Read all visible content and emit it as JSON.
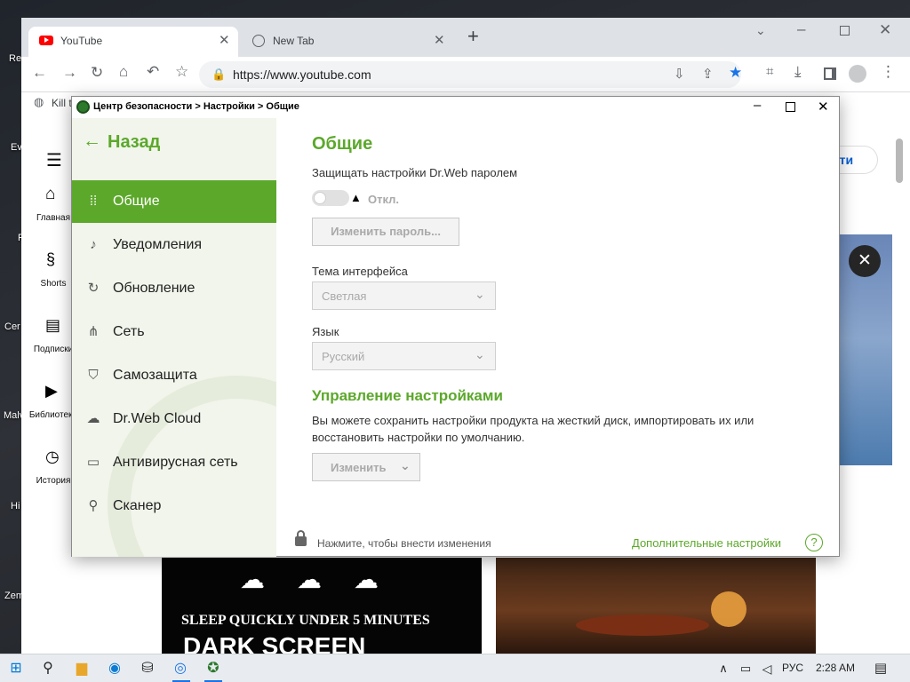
{
  "desktop": {
    "labels": [
      "Re",
      "Ev",
      "F",
      "Cer",
      "Malv",
      "Hi",
      "Zem"
    ]
  },
  "chrome": {
    "tabs": [
      {
        "title": "YouTube"
      },
      {
        "title": "New Tab"
      }
    ],
    "new_tab": "+",
    "url": "https://www.youtube.com",
    "bookmark": "Kill t"
  },
  "youtube": {
    "nav": [
      {
        "label": "Главная"
      },
      {
        "label": "Shorts"
      },
      {
        "label": "Подписки"
      },
      {
        "label": "Библиотека"
      },
      {
        "label": "История"
      }
    ],
    "signin_partial": "йти",
    "thumb_text_1": "SLEEP QUICKLY UNDER 5 MINUTES",
    "thumb_text_2": "DARK SCREEN"
  },
  "drweb": {
    "title": "Центр безопасности > Настройки > Общие",
    "back_label": "Назад",
    "nav": [
      {
        "label": "Общие",
        "active": true
      },
      {
        "label": "Уведомления"
      },
      {
        "label": "Обновление"
      },
      {
        "label": "Сеть"
      },
      {
        "label": "Самозащита"
      },
      {
        "label": "Dr.Web Cloud"
      },
      {
        "label": "Антивирусная сеть"
      },
      {
        "label": "Сканер"
      }
    ],
    "heading": "Общие",
    "password_protect_label": "Защищать настройки Dr.Web паролем",
    "toggle_state": "Откл.",
    "change_password_button": "Изменить пароль...",
    "theme_label": "Тема интерфейса",
    "theme_value": "Светлая",
    "language_label": "Язык",
    "language_value": "Русский",
    "manage_heading": "Управление настройками",
    "manage_description": "Вы можете сохранить настройки продукта на жесткий диск, импортировать их или восстановить настройки по умолчанию.",
    "change_button": "Изменить",
    "lock_hint": "Нажмите, чтобы внести изменения",
    "advanced_link": "Дополнительные настройки",
    "help": "?"
  },
  "taskbar": {
    "language": "РУС",
    "time": "2:28 AM"
  },
  "colors": {
    "accent": "#5ca82b",
    "sidebar_bg": "#f1f5eb",
    "youtube_red": "#ff0000"
  }
}
